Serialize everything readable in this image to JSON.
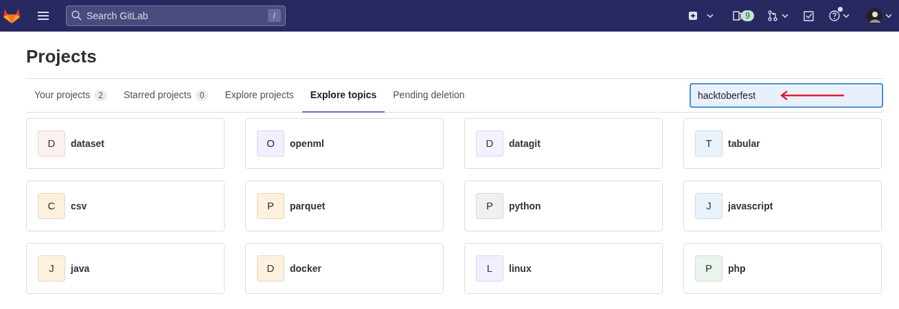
{
  "navbar": {
    "search": {
      "placeholder": "Search GitLab",
      "shortcut": "/"
    },
    "issues_count": "9",
    "help_notification": true
  },
  "page_title": "Projects",
  "tabs": [
    {
      "label": "Your projects",
      "count": "2",
      "selected": false
    },
    {
      "label": "Starred projects",
      "count": "0",
      "selected": false
    },
    {
      "label": "Explore projects",
      "selected": false
    },
    {
      "label": "Explore topics",
      "selected": true
    },
    {
      "label": "Pending deletion",
      "selected": false
    }
  ],
  "filter": {
    "value": "hacktoberfest",
    "focused": true,
    "annotation": {
      "kind": "arrow"
    }
  },
  "topics": [
    {
      "initial": "D",
      "name": "dataset",
      "color": "#fcf1ef"
    },
    {
      "initial": "O",
      "name": "openml",
      "color": "#f0f0ff"
    },
    {
      "initial": "D",
      "name": "datagit",
      "color": "#f4f0ff"
    },
    {
      "initial": "T",
      "name": "tabular",
      "color": "#e9f3fc"
    },
    {
      "initial": "C",
      "name": "csv",
      "color": "#fdf1dd"
    },
    {
      "initial": "P",
      "name": "parquet",
      "color": "#fdf1dd"
    },
    {
      "initial": "P",
      "name": "python",
      "color": "#f0f0f0"
    },
    {
      "initial": "J",
      "name": "javascript",
      "color": "#e9f3fc"
    },
    {
      "initial": "J",
      "name": "java",
      "color": "#fdf1dd"
    },
    {
      "initial": "D",
      "name": "docker",
      "color": "#fdf1dd"
    },
    {
      "initial": "L",
      "name": "linux",
      "color": "#f0f0ff"
    },
    {
      "initial": "P",
      "name": "php",
      "color": "#ecf4ee"
    }
  ]
}
